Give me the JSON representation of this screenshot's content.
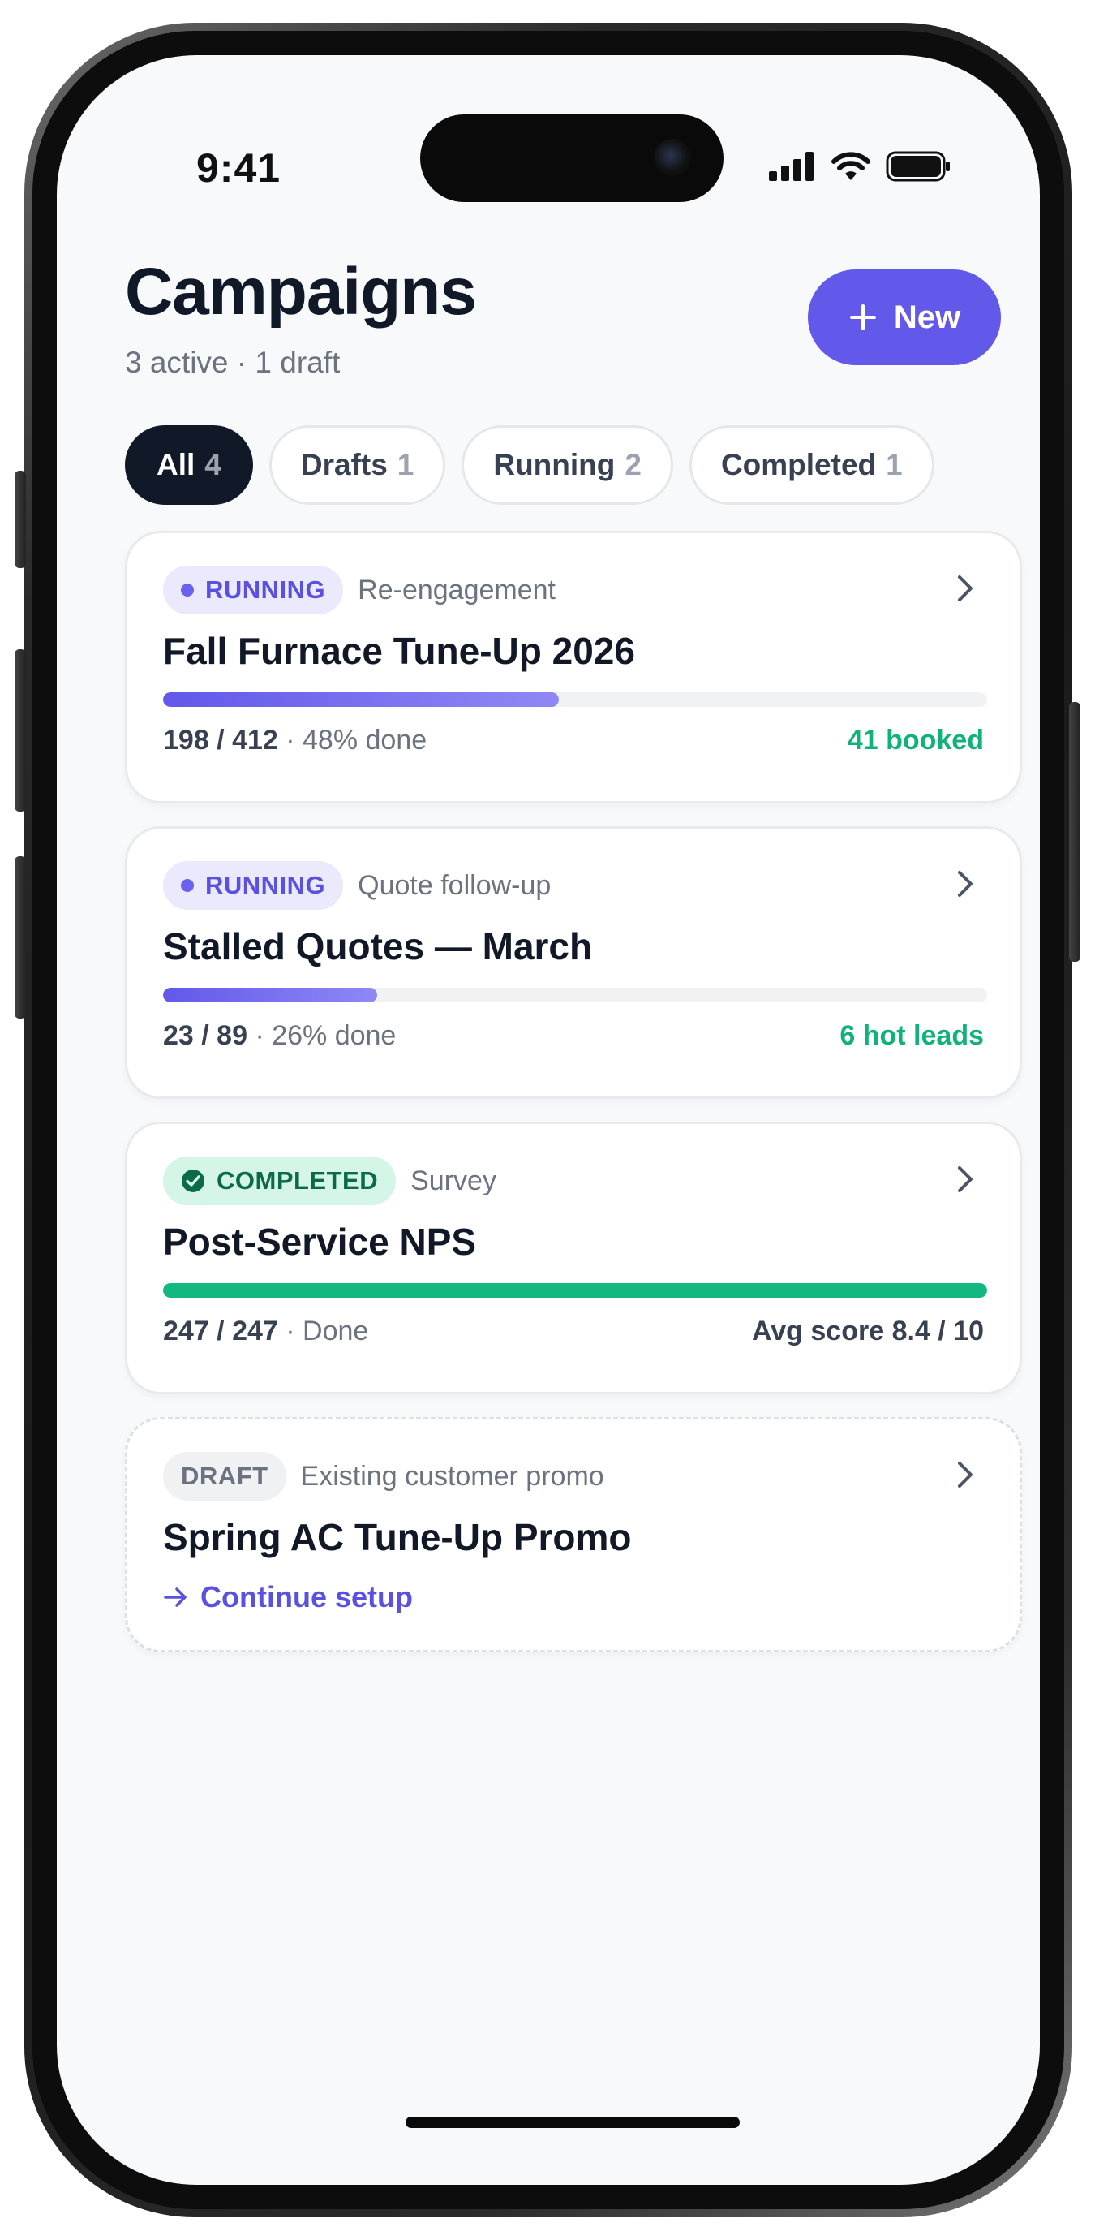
{
  "status_bar": {
    "time": "9:41"
  },
  "header": {
    "title": "Campaigns",
    "subtitle": "3 active · 1 draft",
    "new_button_label": "New"
  },
  "tabs": [
    {
      "label": "All",
      "count": "4",
      "active": true
    },
    {
      "label": "Drafts",
      "count": "1",
      "active": false
    },
    {
      "label": "Running",
      "count": "2",
      "active": false
    },
    {
      "label": "Completed",
      "count": "1",
      "active": false
    }
  ],
  "campaigns": [
    {
      "status": "RUNNING",
      "type": "Re-engagement",
      "title": "Fall Furnace Tune-Up 2026",
      "progress_count": "198 / 412",
      "progress_text": "· 48% done",
      "progress_value": 48,
      "metric": "41 booked"
    },
    {
      "status": "RUNNING",
      "type": "Quote follow-up",
      "title": "Stalled Quotes — March",
      "progress_count": "23 / 89",
      "progress_text": "· 26% done",
      "progress_value": 26,
      "metric": "6 hot leads"
    },
    {
      "status": "COMPLETED",
      "type": "Survey",
      "title": "Post-Service NPS",
      "progress_count": "247 / 247",
      "progress_text": "· Done",
      "progress_value": 100,
      "metric": "Avg score 8.4 / 10"
    },
    {
      "status": "DRAFT",
      "type": "Existing customer promo",
      "title": "Spring AC Tune-Up Promo",
      "action_label": "Continue setup"
    }
  ],
  "colors": {
    "accent": "#6258ea",
    "success": "#10b27c",
    "dark": "#111827",
    "muted": "#6b7280"
  },
  "icons": [
    "plus-icon",
    "chevron-right-icon",
    "check-circle-icon",
    "arrow-right-icon",
    "signal-icon",
    "wifi-icon",
    "battery-icon"
  ]
}
